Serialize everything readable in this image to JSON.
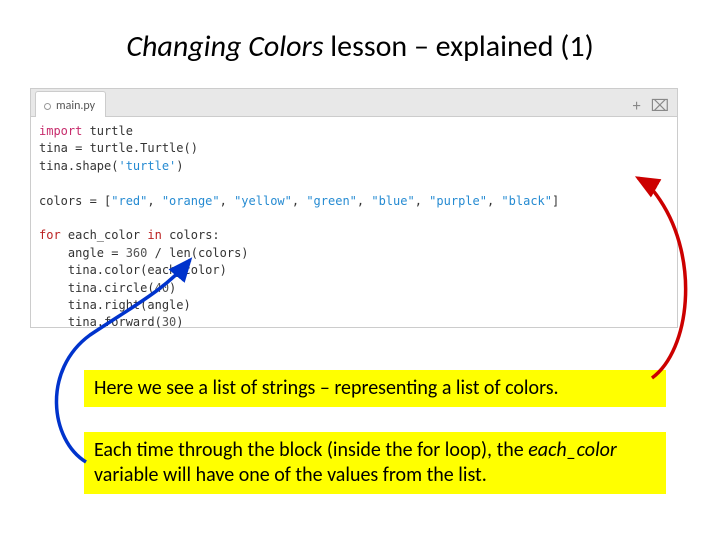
{
  "title": {
    "italic_part": "Changing Colors",
    "rest": " lesson – explained (1)"
  },
  "editor": {
    "filename": "main.py",
    "add_icon_glyph": "+",
    "image_icon_glyph": "⌧"
  },
  "code": {
    "l1_import": "import",
    "l1_rest": " turtle",
    "l2": "tina = turtle.Turtle()",
    "l3a": "tina.shape(",
    "l3s": "'turtle'",
    "l3b": ")",
    "l5a": "colors = [",
    "l5s1": "\"red\"",
    "l5c": ", ",
    "l5s2": "\"orange\"",
    "l5s3": "\"yellow\"",
    "l5s4": "\"green\"",
    "l5s5": "\"blue\"",
    "l5s6": "\"purple\"",
    "l5s7": "\"black\"",
    "l5b": "]",
    "l7_for": "for",
    "l7_mid": " each_color ",
    "l7_in": "in",
    "l7_end": " colors:",
    "l8a": "    angle = ",
    "l8n1": "360",
    "l8b": " / len(colors)",
    "l9": "    tina.color(each_color)",
    "l10a": "    tina.circle(",
    "l10n": "40",
    "l10b": ")",
    "l11": "    tina.right(angle)",
    "l12a": "    tina.forward(",
    "l12n": "30",
    "l12b": ")"
  },
  "callout1": "Here we see a list of strings – representing a list of colors.",
  "callout2_a": "Each time through the block (inside the for loop), the ",
  "callout2_ital": "each_color",
  "callout2_b": " variable will have one of the values from the list."
}
